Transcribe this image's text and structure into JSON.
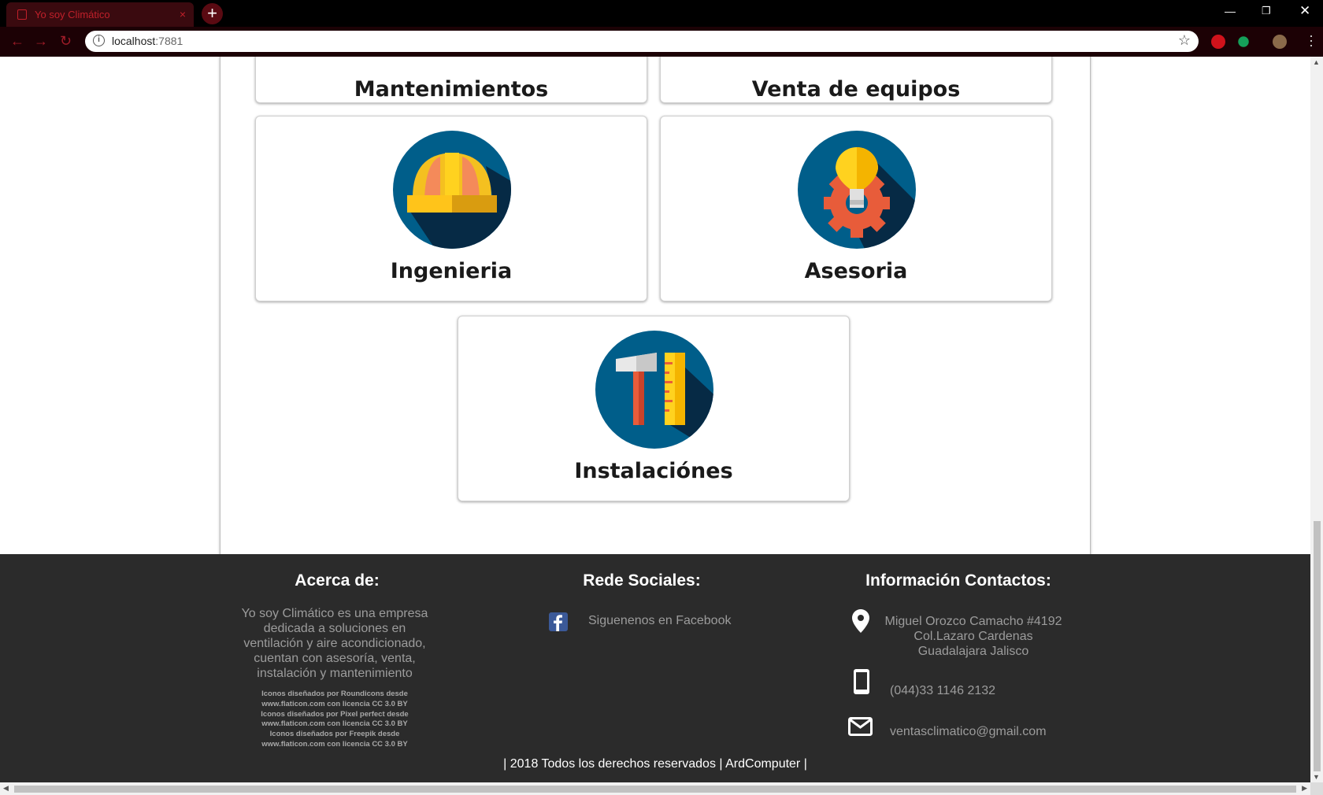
{
  "browser": {
    "tab_title": "Yo soy Climático",
    "tab_close": "×",
    "new_tab": "+",
    "url_host": "localhost",
    "url_port": ":7881"
  },
  "cards": [
    {
      "title": "Mantenimientos"
    },
    {
      "title": "Venta de equipos"
    },
    {
      "title": "Ingenieria",
      "icon": "hard-hat-icon"
    },
    {
      "title": "Asesoria",
      "icon": "lightbulb-gear-icon"
    },
    {
      "title": "Instalaciónes",
      "icon": "hammer-ruler-icon"
    }
  ],
  "footer": {
    "about": {
      "heading": "Acerca de:",
      "text": "Yo soy Climático es una empresa dedicada a soluciones en ventilación y aire acondicionado, cuentan con asesoría, venta, instalación y mantenimiento",
      "credits": [
        "Iconos diseñados por Roundicons desde www.flaticon.com con licencia CC 3.0 BY",
        "Iconos diseñados por Pixel perfect desde www.flaticon.com con licencia CC 3.0 BY",
        "Iconos diseñados por Freepik desde www.flaticon.com con licencia CC 3.0 BY"
      ]
    },
    "social": {
      "heading": "Rede Sociales:",
      "facebook_label": "Siguenenos en Facebook"
    },
    "contact": {
      "heading": "Información Contactos:",
      "address_line1": "Miguel Orozco Camacho #4192",
      "address_line2": "Col.Lazaro Cardenas",
      "address_line3": "Guadalajara Jalisco",
      "phone": "(044)33 1146 2132",
      "email": "ventasclimatico@gmail.com"
    },
    "copyright": "| 2018 Todos los derechos reservados | ArdComputer |"
  },
  "colors": {
    "footer_bg": "#2b2b2b",
    "icon_circle": "#005e8a",
    "browser_accent": "#a01c28"
  }
}
